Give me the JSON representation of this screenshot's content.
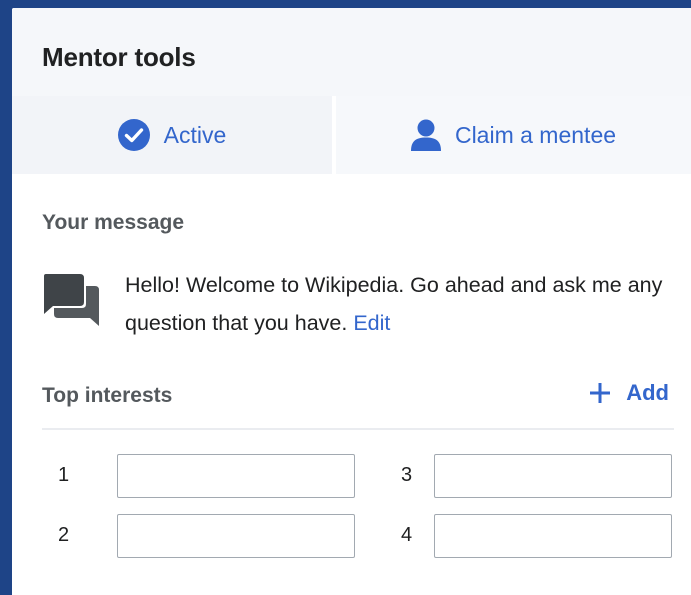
{
  "title": "Mentor tools",
  "tabs": {
    "active": {
      "label": "Active",
      "icon": "check-circle-icon"
    },
    "claim": {
      "label": "Claim a mentee",
      "icon": "user-icon"
    }
  },
  "message": {
    "heading": "Your message",
    "icon": "speech-bubbles-icon",
    "text": "Hello! Welcome to Wikipedia. Go ahead and ask me any question that you have.",
    "edit_label": "Edit"
  },
  "interests": {
    "heading": "Top interests",
    "add_label": "Add",
    "add_icon": "plus-icon",
    "items": [
      {
        "number": "1",
        "value": ""
      },
      {
        "number": "2",
        "value": ""
      },
      {
        "number": "3",
        "value": ""
      },
      {
        "number": "4",
        "value": ""
      }
    ]
  },
  "colors": {
    "accent": "#3366cc",
    "frame": "#1e4487",
    "header_bg": "#f5f7fa",
    "text": "#202122",
    "muted_text": "#54595d"
  }
}
